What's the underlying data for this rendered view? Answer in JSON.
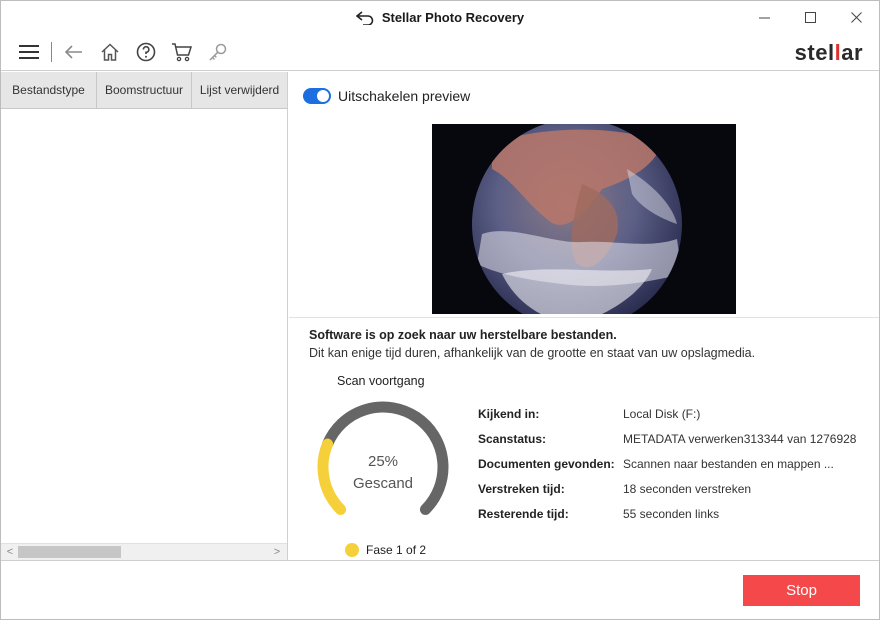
{
  "window": {
    "title": "Stellar Photo Recovery",
    "title_icon": "undo-arrow-icon"
  },
  "window_controls": {
    "minimize": "─",
    "maximize": "☐",
    "close": "✕"
  },
  "toolbar": {
    "icons": [
      "menu-icon",
      "back-arrow-icon",
      "home-icon",
      "help-icon",
      "cart-icon",
      "key-icon"
    ],
    "brand": {
      "before": "stel",
      "accent": "l",
      "after": "ar"
    }
  },
  "left_panel": {
    "tabs": [
      "Bestandstype",
      "Boomstructuur",
      "Lijst verwijderd"
    ],
    "scroll_left": "<",
    "scroll_right": ">"
  },
  "preview": {
    "toggle_label": "Uitschakelen preview",
    "toggle_on": true
  },
  "status": {
    "title": "Software is op zoek naar uw herstelbare bestanden.",
    "subtitle": "Dit kan enige tijd duren, afhankelijk van de grootte en staat van uw opslagmedia."
  },
  "scan": {
    "title": "Scan voortgang",
    "percent": "25%",
    "percent_value": 25,
    "label": "Gescand",
    "phase": "Fase 1 of 2",
    "colors": {
      "progress": "#f5d03a",
      "track": "#666666"
    }
  },
  "info": [
    {
      "key": "Kijkend in:",
      "value": "Local Disk (F:)"
    },
    {
      "key": "Scanstatus:",
      "value": "METADATA verwerken313344 van 1276928"
    },
    {
      "key": "Documenten gevonden:",
      "value": "Scannen naar bestanden en mappen ..."
    },
    {
      "key": "Verstreken tijd:",
      "value": "18 seconden verstreken"
    },
    {
      "key": "Resterende tijd:",
      "value": "55 seconden links"
    }
  ],
  "footer": {
    "stop_label": "Stop",
    "stop_color": "#f4484a"
  }
}
